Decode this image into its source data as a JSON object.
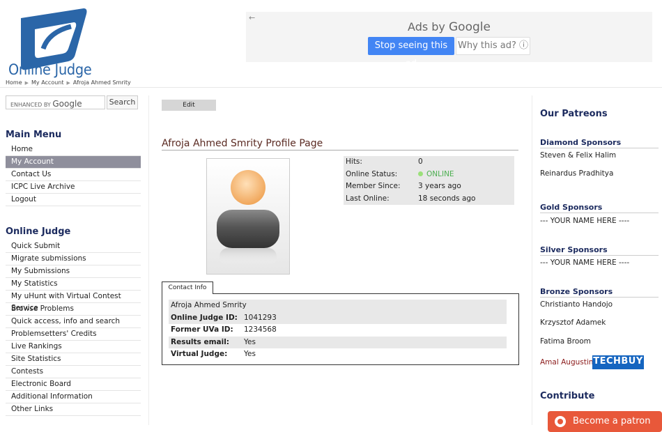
{
  "header": {
    "logo_text": "Online Judge",
    "breadcrumb": [
      "Home",
      "My Account",
      "Afroja Ahmed Smrity"
    ]
  },
  "ad": {
    "ads_by": "Ads by",
    "google": "Google",
    "stop_label": "Stop seeing this ad",
    "why_label": "Why this ad? ⓘ"
  },
  "search": {
    "enhanced": "ENHANCED BY",
    "google": "Google",
    "button": "Search"
  },
  "main_menu": {
    "title": "Main Menu",
    "items": [
      "Home",
      "My Account",
      "Contact Us",
      "ICPC Live Archive",
      "Logout"
    ],
    "active_index": 1
  },
  "online_judge_menu": {
    "title": "Online Judge",
    "items": [
      "Quick Submit",
      "Migrate submissions",
      "My Submissions",
      "My Statistics",
      "My uHunt with Virtual Contest Service",
      "Browse Problems",
      "Quick access, info and search",
      "Problemsetters' Credits",
      "Live Rankings",
      "Site Statistics",
      "Contests",
      "Electronic Board",
      "Additional Information",
      "Other Links"
    ]
  },
  "profile": {
    "edit_label": "Edit",
    "title": "Afroja Ahmed Smrity Profile Page",
    "stats": [
      {
        "k": "Hits:",
        "v": "0"
      },
      {
        "k": "Online Status:",
        "v": "ONLINE"
      },
      {
        "k": "Member Since:",
        "v": "3 years ago"
      },
      {
        "k": "Last Online:",
        "v": "18 seconds ago"
      }
    ],
    "contact_tab": "Contact Info",
    "contact_name": "Afroja Ahmed Smrity",
    "contact_rows": [
      {
        "k": "Online Judge ID:",
        "v": "1041293"
      },
      {
        "k": "Former UVa ID:",
        "v": "1234568"
      },
      {
        "k": "Results email:",
        "v": "Yes"
      },
      {
        "k": "Virtual Judge:",
        "v": "Yes"
      }
    ]
  },
  "patreons": {
    "title": "Our Patreons",
    "diamond_title": "Diamond Sponsors",
    "diamond": [
      "Steven & Felix Halim",
      "Reinardus Pradhitya"
    ],
    "gold_title": "Gold Sponsors",
    "gold": "--- YOUR NAME HERE ----",
    "silver_title": "Silver Sponsors",
    "silver": "--- YOUR NAME HERE ----",
    "bronze_title": "Bronze Sponsors",
    "bronze": [
      "Christianto Handojo",
      "Krzysztof Adamek",
      "Fatima Broom",
      "Amal Augustine"
    ],
    "techbuy": "TECHBUY",
    "contribute_title": "Contribute",
    "patreon_button": "Become a patron"
  },
  "colors": {
    "accent_blue": "#2b66a8",
    "menu_title": "#1b2a5e",
    "active_menu": "#8f8f9c",
    "online_green": "#4caf50",
    "patreon": "#e8583a"
  }
}
